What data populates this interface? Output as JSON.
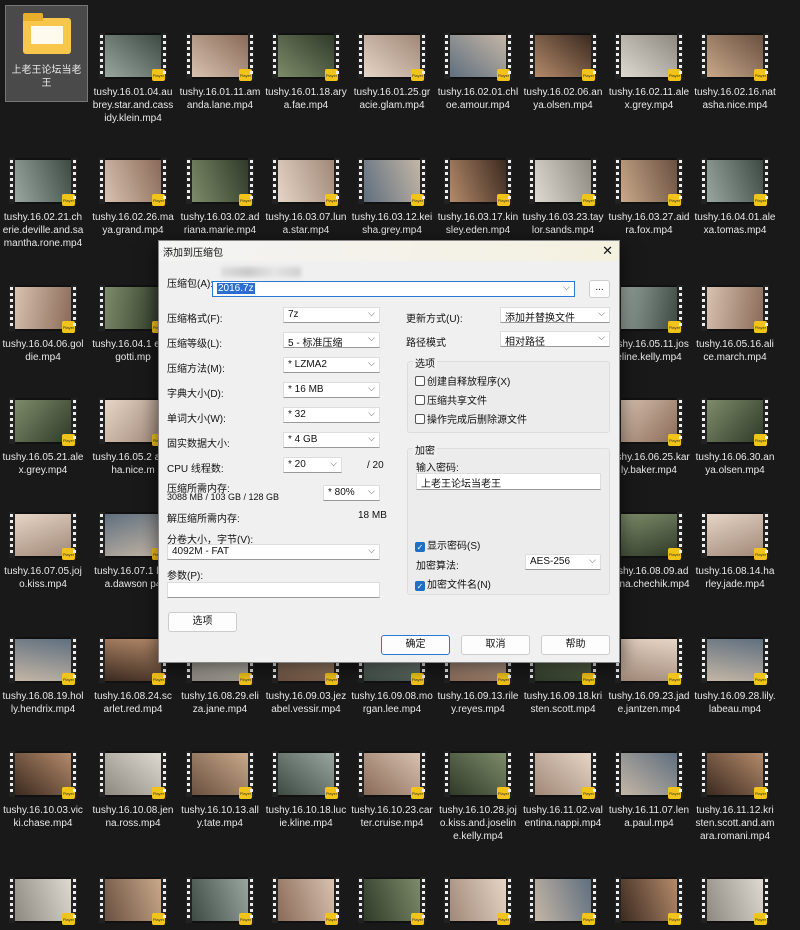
{
  "folder": {
    "name": "上老王论坛当老王"
  },
  "rows": [
    [
      "tushy.16.01.04.aubrey.star.and.cassidy.klein.mp4",
      "tushy.16.01.11.amanda.lane.mp4",
      "tushy.16.01.18.arya.fae.mp4",
      "tushy.16.01.25.gracie.glam.mp4",
      "tushy.16.02.01.chloe.amour.mp4",
      "tushy.16.02.06.anya.olsen.mp4",
      "tushy.16.02.11.alex.grey.mp4",
      "tushy.16.02.16.natasha.nice.mp4"
    ],
    [
      "tushy.16.02.21.cherie.deville.and.samantha.rone.mp4",
      "tushy.16.02.26.maya.grand.mp4",
      "tushy.16.03.02.adriana.marie.mp4",
      "tushy.16.03.07.luna.star.mp4",
      "tushy.16.03.12.keisha.grey.mp4",
      "tushy.16.03.17.kinsley.eden.mp4",
      "tushy.16.03.23.taylor.sands.mp4",
      "tushy.16.03.27.aidra.fox.mp4",
      "tushy.16.04.01.alexa.tomas.mp4"
    ],
    [
      "tushy.16.04.06.goldie.mp4",
      "tushy.16.04.1 eah.gotti.mp",
      "",
      "",
      "",
      "",
      "",
      "tushy.16.05.11.joseline.kelly.mp4",
      "tushy.16.05.16.alice.march.mp4"
    ],
    [
      "tushy.16.05.21.alex.grey.mp4",
      "tushy.16.05.2 atasha.nice.m",
      "",
      "",
      "",
      "",
      "",
      "tushy.16.06.25.karly.baker.mp4",
      "tushy.16.06.30.anya.olsen.mp4"
    ],
    [
      "tushy.16.07.05.jojo.kiss.mp4",
      "tushy.16.07.1 laina.dawson p4",
      "",
      "",
      "",
      "",
      "",
      "tushy.16.08.09.adriana.chechik.mp4",
      "tushy.16.08.14.harley.jade.mp4"
    ],
    [
      "tushy.16.08.19.holly.hendrix.mp4",
      "tushy.16.08.24.scarlet.red.mp4",
      "tushy.16.08.29.eliza.jane.mp4",
      "tushy.16.09.03.jezabel.vessir.mp4",
      "tushy.16.09.08.morgan.lee.mp4",
      "tushy.16.09.13.riley.reyes.mp4",
      "tushy.16.09.18.kristen.scott.mp4",
      "tushy.16.09.23.jade.jantzen.mp4",
      "tushy.16.09.28.lily.labeau.mp4"
    ],
    [
      "tushy.16.10.03.vicki.chase.mp4",
      "tushy.16.10.08.jenna.ross.mp4",
      "tushy.16.10.13.ally.tate.mp4",
      "tushy.16.10.18.lucie.kline.mp4",
      "tushy.16.10.23.carter.cruise.mp4",
      "tushy.16.10.28.jojo.kiss.and.joseline.kelly.mp4",
      "tushy.16.11.02.valentina.nappi.mp4",
      "tushy.16.11.07.lena.paul.mp4",
      "tushy.16.11.12.kristen.scott.and.amara.romani.mp4"
    ],
    [
      "",
      "",
      "",
      "",
      "",
      "",
      "",
      "",
      ""
    ]
  ],
  "badge": "Player",
  "dialog": {
    "title": "添加到压缩包",
    "archive_label": "压缩包(A):",
    "archive_value": "2016.7z",
    "browse": "...",
    "format_label": "压缩格式(F):",
    "format": "7z",
    "level_label": "压缩等级(L):",
    "level": "5 - 标准压缩",
    "method_label": "压缩方法(M):",
    "method": "* LZMA2",
    "dict_label": "字典大小(D):",
    "dict": "* 16 MB",
    "word_label": "单词大小(W):",
    "word": "* 32",
    "solid_label": "固实数据大小:",
    "solid": "* 4 GB",
    "cpu_label": "CPU 线程数:",
    "cpu": "* 20",
    "cpu_max": "/ 20",
    "mem_label": "压缩所需内存:",
    "mem_detail": "3088 MB / 103 GB / 128 GB",
    "mem_pct": "* 80%",
    "dmem_label": "解压缩所需内存:",
    "dmem": "18 MB",
    "split_label": "分卷大小，字节(V):",
    "split": "4092M - FAT",
    "params_label": "参数(P):",
    "params": "",
    "update_label": "更新方式(U):",
    "update": "添加并替换文件",
    "path_label": "路径模式",
    "path": "相对路径",
    "options_group": "选项",
    "opt_sfx": "创建自释放程序(X)",
    "opt_shared": "压缩共享文件",
    "opt_delete": "操作完成后删除源文件",
    "enc_group": "加密",
    "pwd_label": "输入密码:",
    "pwd": "上老王论坛当老王",
    "show_pwd": "显示密码(S)",
    "enc_method_label": "加密算法:",
    "enc_method": "AES-256",
    "enc_names": "加密文件名(N)",
    "options_btn": "选项",
    "ok": "确定",
    "cancel": "取消",
    "help": "帮助"
  }
}
